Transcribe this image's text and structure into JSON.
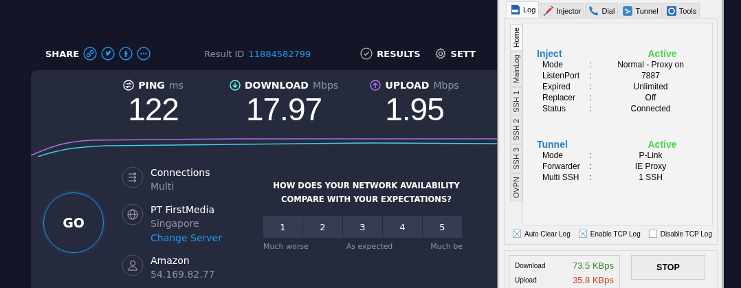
{
  "share": {
    "label": "SHARE"
  },
  "result": {
    "label": "Result ID",
    "id": "11884582799"
  },
  "nav": [
    {
      "kind": "results",
      "label": "RESULTS"
    },
    {
      "kind": "settings",
      "label": "SETT"
    }
  ],
  "metrics": [
    {
      "kind": "ping",
      "label": "PING",
      "unit": "ms",
      "value": "122"
    },
    {
      "kind": "download",
      "label": "DOWNLOAD",
      "unit": "Mbps",
      "value": "17.97"
    },
    {
      "kind": "upload",
      "label": "UPLOAD",
      "unit": "Mbps",
      "value": "1.95"
    }
  ],
  "go_button": "GO",
  "server_info": [
    {
      "kind": "connections",
      "title": "Connections",
      "subtitle": "Multi"
    },
    {
      "kind": "server",
      "title": "PT FirstMedia",
      "subtitle": "Singapore",
      "link": "Change Server"
    },
    {
      "kind": "host",
      "title": "Amazon",
      "subtitle": "54.169.82.77"
    }
  ],
  "survey": {
    "question_lines": [
      "HOW DOES YOUR NETWORK AVAILABILITY",
      "COMPARE WITH YOUR EXPECTATIONS?"
    ],
    "options": [
      "1",
      "2",
      "3",
      "4",
      "5"
    ],
    "scale_labels": [
      "Much worse",
      "As expected",
      "Much be"
    ]
  },
  "injector": {
    "tabs": [
      {
        "kind": "log",
        "label": "Log",
        "selected": true
      },
      {
        "kind": "injector",
        "label": "Injector",
        "selected": false
      },
      {
        "kind": "dial",
        "label": "Dial",
        "selected": false
      },
      {
        "kind": "tunnel",
        "label": "Tunnel",
        "selected": false
      },
      {
        "kind": "tools",
        "label": "Tools",
        "selected": false
      }
    ],
    "side_tabs": [
      {
        "label": "Home",
        "selected": true
      },
      {
        "label": "MainLog",
        "selected": false
      },
      {
        "label": "SSH 1",
        "selected": false
      },
      {
        "label": "SSH 2",
        "selected": false
      },
      {
        "label": "SSH 3",
        "selected": false
      },
      {
        "label": "OVPN",
        "selected": false
      }
    ],
    "separator": ":",
    "sections": [
      {
        "title": "Inject",
        "status": "Active",
        "rows": [
          {
            "label": "Mode",
            "value": "Normal - Proxy on"
          },
          {
            "label": "ListenPort",
            "value": "7887"
          },
          {
            "label": "Expired",
            "value": "Unlimited"
          },
          {
            "label": "Replacer",
            "value": "Off"
          },
          {
            "label": "Status",
            "value": "Connected"
          }
        ]
      },
      {
        "title": "Tunnel",
        "status": "Active",
        "rows": [
          {
            "label": "Mode",
            "value": "P-Link"
          },
          {
            "label": "Forwarder",
            "value": "IE Proxy"
          },
          {
            "label": "Multi SSH",
            "value": "1 SSH"
          }
        ]
      }
    ],
    "checkboxes": [
      {
        "label": "Auto Clear Log",
        "checked": true
      },
      {
        "label": "Enable TCP Log",
        "checked": true
      },
      {
        "label": "Disable TCP Log",
        "checked": false
      }
    ],
    "stats": [
      {
        "kind": "download",
        "label": "Download",
        "value": "73.5 KBps"
      },
      {
        "kind": "upload",
        "label": "Upload",
        "value": "35.8 KBps"
      }
    ],
    "stop_button": "STOP"
  }
}
